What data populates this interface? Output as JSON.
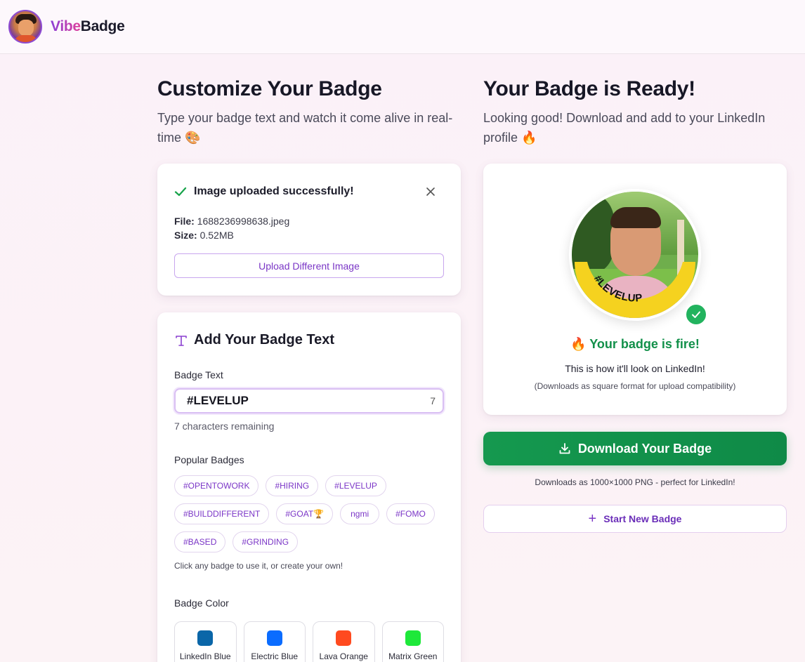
{
  "header": {
    "brand_part1": "Vibe",
    "brand_part2": "Badge"
  },
  "left": {
    "title": "Customize Your Badge",
    "subtitle": "Type your badge text and watch it come alive in real-time 🎨",
    "upload": {
      "message": "Image uploaded successfully!",
      "file_label": "File:",
      "file_value": "1688236998638.jpeg",
      "size_label": "Size:",
      "size_value": "0.52MB",
      "button": "Upload Different Image"
    },
    "text_card": {
      "heading": "Add Your Badge Text",
      "badge_text_label": "Badge Text",
      "badge_text_value": "#LEVELUP",
      "char_count": "7",
      "remaining": "7 characters remaining",
      "popular_label": "Popular Badges",
      "popular": [
        "#OPENTOWORK",
        "#HIRING",
        "#LEVELUP",
        "#BUILDDIFFERENT",
        "#GOAT🏆",
        "ngmi",
        "#FOMO",
        "#BASED",
        "#GRINDING"
      ],
      "hint": "Click any badge to use it, or create your own!",
      "color_label": "Badge Color",
      "colors": [
        {
          "name": "LinkedIn Blue",
          "hex": "#0a66a8"
        },
        {
          "name": "Electric Blue",
          "hex": "#0a6cff"
        },
        {
          "name": "Lava Orange",
          "hex": "#ff4a1f"
        },
        {
          "name": "Matrix Green",
          "hex": "#1ee83a"
        }
      ]
    }
  },
  "right": {
    "title": "Your Badge is Ready!",
    "subtitle": "Looking good! Download and add to your LinkedIn profile 🔥",
    "badge_ring_text": "#LEVELUP",
    "badge_ring_color": "#f5d21f",
    "fire_line": "🔥 Your badge is fire!",
    "look_line": "This is how it'll look on LinkedIn!",
    "square_line": "(Downloads as square format for upload compatibility)",
    "download_button": "Download Your Badge",
    "download_note": "Downloads as 1000×1000 PNG - perfect for LinkedIn!",
    "new_button": "Start New Badge"
  }
}
